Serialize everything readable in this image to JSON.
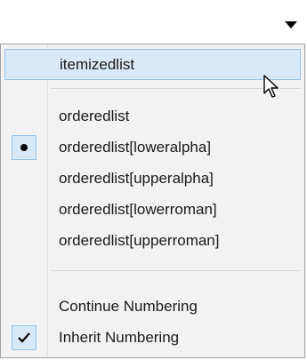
{
  "menu": {
    "items": [
      {
        "label": "itemizedlist"
      },
      {
        "label": "orderedlist"
      },
      {
        "label": "orderedlist[loweralpha]"
      },
      {
        "label": "orderedlist[upperalpha]"
      },
      {
        "label": "orderedlist[lowerroman]"
      },
      {
        "label": "orderedlist[upperroman]"
      },
      {
        "label": "Continue Numbering"
      },
      {
        "label": "Inherit Numbering"
      }
    ]
  },
  "icons": {
    "toggle": "caret-down-icon",
    "selected_marker": "bullet-icon",
    "checked_marker": "checkmark-icon",
    "pointer": "mouse-pointer-icon"
  },
  "colors": {
    "menu_background": "#f2f2f2",
    "hover_background": "#d9e8f6",
    "hover_border": "#96c3ea",
    "menu_border": "#a0a0a0"
  }
}
